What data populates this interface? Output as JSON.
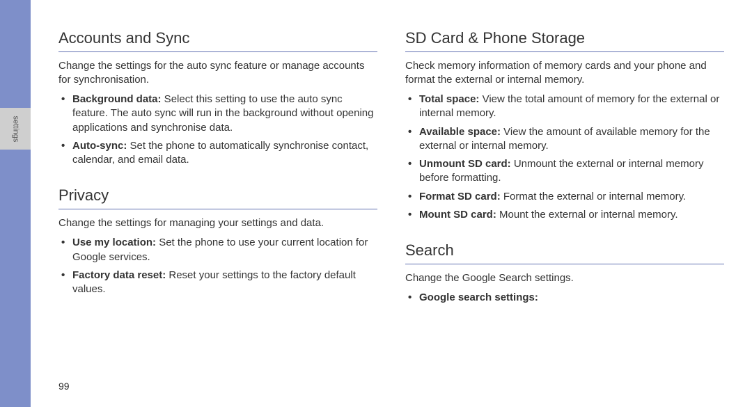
{
  "sidebar": {
    "tab_label": "settings"
  },
  "page_number": "99",
  "left": {
    "section1": {
      "title": "Accounts and Sync",
      "intro": "Change the settings for the auto sync feature or manage accounts for synchronisation.",
      "items": [
        {
          "bold": "Background data:",
          "rest": " Select this setting to use the auto sync feature. The auto sync will run in the background without opening applications and synchronise data."
        },
        {
          "bold": "Auto-sync:",
          "rest": " Set the phone to automatically synchronise contact, calendar, and email data."
        }
      ]
    },
    "section2": {
      "title": "Privacy",
      "intro": "Change the settings for managing your settings and data.",
      "items": [
        {
          "bold": "Use my location:",
          "rest": " Set the phone to use your current location for Google services."
        },
        {
          "bold": "Factory data reset:",
          "rest": " Reset your settings to the factory default values."
        }
      ]
    }
  },
  "right": {
    "section1": {
      "title": "SD Card & Phone Storage",
      "intro": "Check memory information of memory cards and your phone and format the external or internal memory.",
      "items": [
        {
          "bold": "Total space:",
          "rest": " View the total amount of memory for the external or internal memory."
        },
        {
          "bold": "Available space:",
          "rest": " View the amount of available memory for the external or internal memory."
        },
        {
          "bold": "Unmount SD card:",
          "rest": " Unmount the external or internal memory before formatting."
        },
        {
          "bold": "Format SD card:",
          "rest": " Format the external or internal memory."
        },
        {
          "bold": "Mount SD card:",
          "rest": " Mount the external or internal memory."
        }
      ]
    },
    "section2": {
      "title": "Search",
      "intro": "Change the Google Search settings.",
      "items": [
        {
          "bold": "Google search settings:",
          "rest": ""
        }
      ]
    }
  }
}
